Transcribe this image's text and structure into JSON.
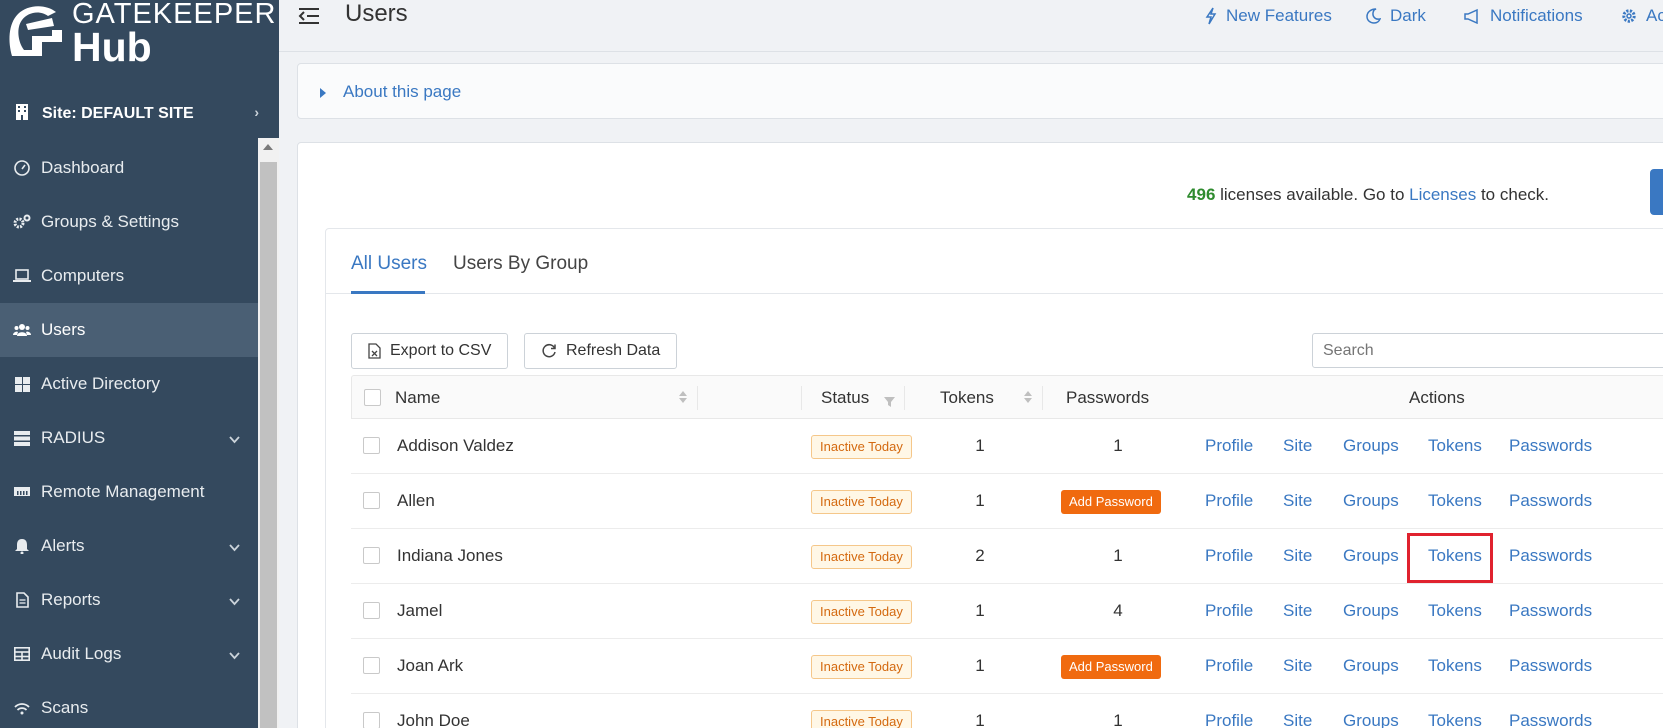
{
  "brand": {
    "top": "GATEKEEPER",
    "bottom": "Hub"
  },
  "site": {
    "label": "Site: DEFAULT SITE"
  },
  "sidebar": {
    "items": [
      {
        "label": "Dashboard",
        "icon": "dashboard-icon"
      },
      {
        "label": "Groups & Settings",
        "icon": "gears-icon"
      },
      {
        "label": "Computers",
        "icon": "laptop-icon"
      },
      {
        "label": "Users",
        "icon": "users-icon",
        "active": true
      },
      {
        "label": "Active Directory",
        "icon": "windows-icon"
      },
      {
        "label": "RADIUS",
        "icon": "server-icon",
        "dropdown": true
      },
      {
        "label": "Remote Management",
        "icon": "ethernet-icon"
      },
      {
        "label": "Alerts",
        "icon": "bell-icon",
        "dropdown": true
      },
      {
        "label": "Reports",
        "icon": "file-icon",
        "dropdown": true
      },
      {
        "label": "Audit Logs",
        "icon": "table-icon",
        "dropdown": true
      },
      {
        "label": "Scans",
        "icon": "wifi-icon"
      }
    ]
  },
  "header": {
    "title": "Users",
    "actions": [
      {
        "label": "New Features",
        "icon": "bolt-icon"
      },
      {
        "label": "Dark",
        "icon": "moon-icon"
      },
      {
        "label": "Notifications",
        "icon": "megaphone-icon"
      },
      {
        "label": "Ac",
        "icon": "gear-icon"
      }
    ]
  },
  "about": {
    "label": "About this page"
  },
  "licenses": {
    "count": "496",
    "text_before": " licenses available. Go to ",
    "link": "Licenses",
    "text_after": " to check."
  },
  "tabs": [
    {
      "label": "All Users",
      "active": true
    },
    {
      "label": "Users By Group"
    }
  ],
  "toolbar": {
    "export_label": "Export to CSV",
    "refresh_label": "Refresh Data",
    "search_placeholder": "Search"
  },
  "table": {
    "columns": {
      "name": "Name",
      "status": "Status",
      "tokens": "Tokens",
      "passwords": "Passwords",
      "actions": "Actions"
    },
    "action_labels": {
      "profile": "Profile",
      "site": "Site",
      "groups": "Groups",
      "tokens": "Tokens",
      "passwords": "Passwords"
    },
    "add_password_label": "Add Password",
    "rows": [
      {
        "name": "Addison Valdez",
        "status": "Inactive Today",
        "tokens": "1",
        "passwords": "1"
      },
      {
        "name": "Allen",
        "status": "Inactive Today",
        "tokens": "1",
        "passwords": null
      },
      {
        "name": "Indiana Jones",
        "status": "Inactive Today",
        "tokens": "2",
        "passwords": "1"
      },
      {
        "name": "Jamel",
        "status": "Inactive Today",
        "tokens": "1",
        "passwords": "4"
      },
      {
        "name": "Joan Ark",
        "status": "Inactive Today",
        "tokens": "1",
        "passwords": null
      },
      {
        "name": "John Doe",
        "status": "Inactive Today",
        "tokens": "1",
        "passwords": "1"
      }
    ]
  }
}
